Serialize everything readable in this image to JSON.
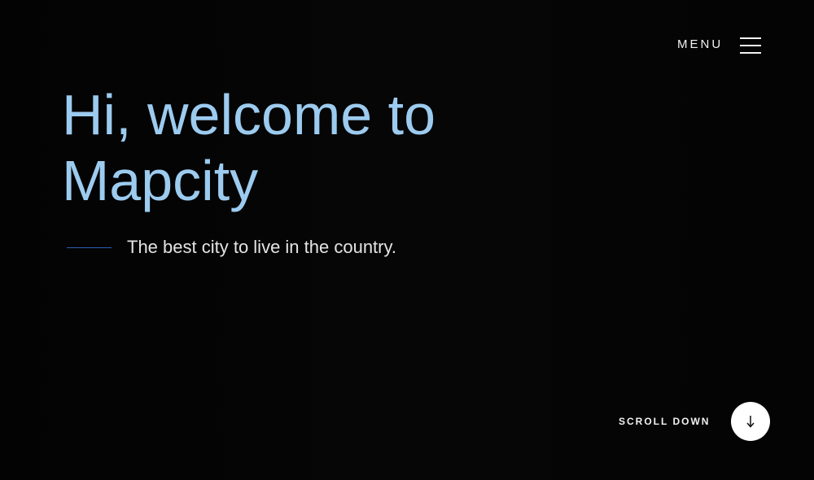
{
  "header": {
    "menu_label": "MENU",
    "menu_icon": "hamburger-icon"
  },
  "hero": {
    "title_line1": "Hi, welcome to",
    "title_line2": "Mapcity",
    "subtitle": "The best city to live in the country."
  },
  "scroll": {
    "label": "SCROLL DOWN",
    "icon": "arrow-down-icon"
  },
  "colors": {
    "background": "#050505",
    "title": "#9ccbef",
    "accent_line": "#2a5fb0",
    "text": "#f2f2f2"
  }
}
